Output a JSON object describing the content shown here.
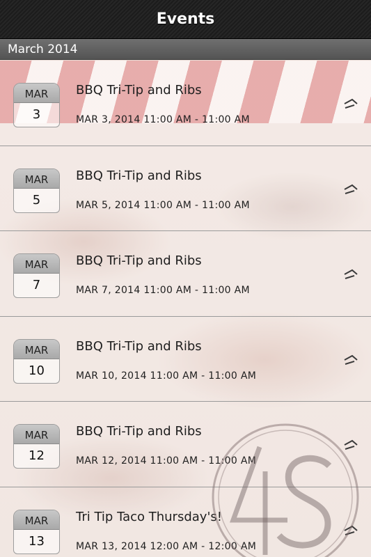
{
  "header": {
    "title": "Events"
  },
  "section": {
    "title": "March 2014"
  },
  "events": [
    {
      "month": "MAR",
      "day": "3",
      "title": "BBQ Tri-Tip and Ribs",
      "datetime": "MAR 3, 2014  11:00 AM - 11:00 AM"
    },
    {
      "month": "MAR",
      "day": "5",
      "title": "BBQ Tri-Tip and Ribs",
      "datetime": "MAR 5, 2014  11:00 AM - 11:00 AM"
    },
    {
      "month": "MAR",
      "day": "7",
      "title": "BBQ Tri-Tip and Ribs",
      "datetime": "MAR 7, 2014  11:00 AM - 11:00 AM"
    },
    {
      "month": "MAR",
      "day": "10",
      "title": "BBQ Tri-Tip and Ribs",
      "datetime": "MAR 10, 2014  11:00 AM - 11:00 AM"
    },
    {
      "month": "MAR",
      "day": "12",
      "title": "BBQ Tri-Tip and Ribs",
      "datetime": "MAR 12, 2014  11:00 AM - 11:00 AM"
    },
    {
      "month": "MAR",
      "day": "13",
      "title": "Tri Tip Taco Thursday's!",
      "datetime": "MAR 13, 2014  12:00 AM - 12:00 AM"
    }
  ],
  "icons": {
    "row_disclosure": "chevron-right-icon",
    "watermark": "4s-logo"
  },
  "colors": {
    "topbar": "#1f1f1f",
    "section_header": "#5e5e5e",
    "awning_red": "#cd4646"
  }
}
